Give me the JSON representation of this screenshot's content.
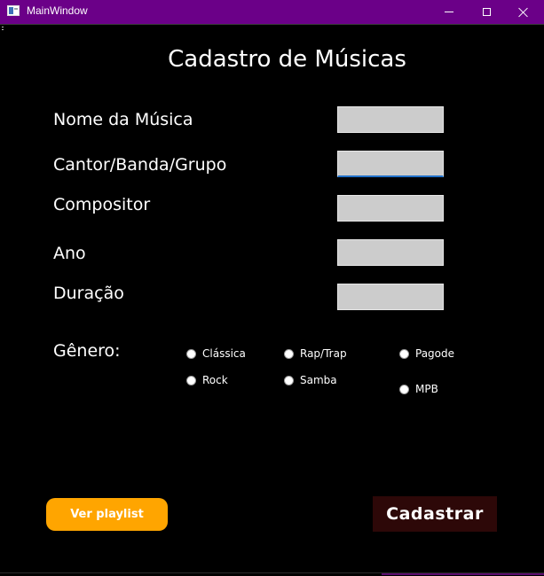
{
  "window": {
    "title": "MainWindow",
    "icon": "app-window-icon",
    "titlebar_color": "#6b0088"
  },
  "form": {
    "title": "Cadastro de Músicas",
    "fields": [
      {
        "label": "Nome da Música",
        "value": ""
      },
      {
        "label": "Cantor/Banda/Grupo",
        "value": ""
      },
      {
        "label": "Compositor",
        "value": ""
      },
      {
        "label": "Ano",
        "value": ""
      },
      {
        "label": "Duração",
        "value": ""
      }
    ],
    "genre": {
      "label": "Gênero:",
      "options": [
        "Clássica",
        "Rap/Trap",
        "Pagode",
        "Rock",
        "Samba",
        "MPB"
      ]
    },
    "buttons": {
      "playlist": "Ver playlist",
      "submit": "Cadastrar"
    }
  },
  "colors": {
    "background": "#000000",
    "input_bg": "#cccccc",
    "playlist_button": "#ffa500",
    "submit_button": "#2d0808",
    "focus_underline": "#1f6fc9"
  }
}
